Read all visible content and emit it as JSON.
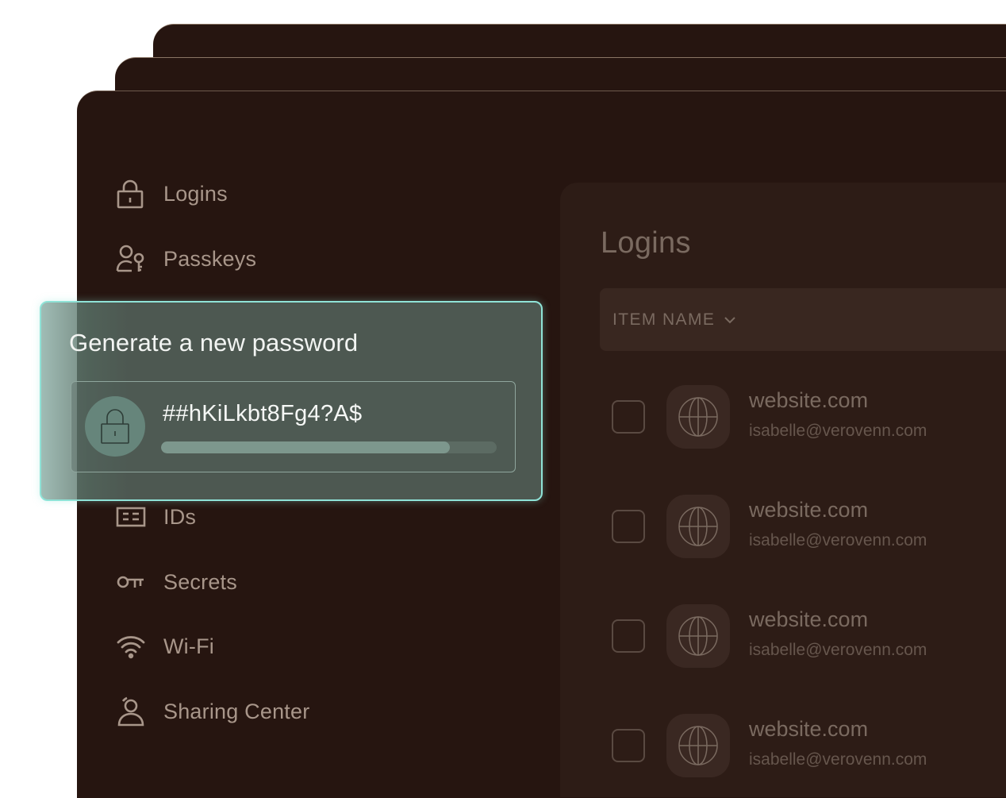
{
  "sidebar": {
    "items": [
      {
        "label": "Logins",
        "icon": "lock-icon"
      },
      {
        "label": "Passkeys",
        "icon": "passkey-icon"
      },
      {
        "label": "IDs",
        "icon": "id-card-icon"
      },
      {
        "label": "Secrets",
        "icon": "key-icon"
      },
      {
        "label": "Wi-Fi",
        "icon": "wifi-icon"
      },
      {
        "label": "Sharing Center",
        "icon": "sharing-icon"
      }
    ]
  },
  "main": {
    "title": "Logins",
    "column_header": "ITEM NAME",
    "rows": [
      {
        "site": "website.com",
        "email": "isabelle@verovenn.com"
      },
      {
        "site": "website.com",
        "email": "isabelle@verovenn.com"
      },
      {
        "site": "website.com",
        "email": "isabelle@verovenn.com"
      },
      {
        "site": "website.com",
        "email": "isabelle@verovenn.com"
      }
    ]
  },
  "generator": {
    "title": "Generate a new password",
    "password": "##hKiLkbt8Fg4?A$",
    "strength": 0.86
  },
  "colors": {
    "background": "#261510",
    "accent": "#8fe3d7",
    "overlay": "#4d5851"
  }
}
